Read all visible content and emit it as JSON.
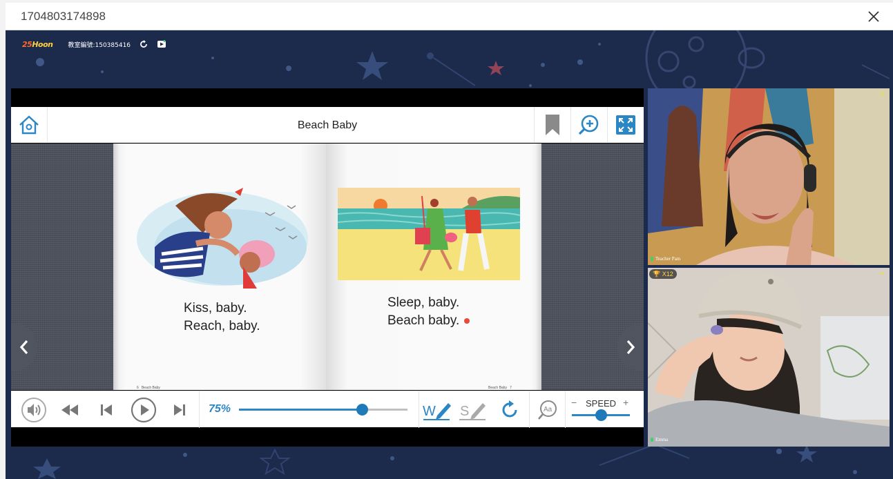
{
  "window": {
    "title": "1704803174898"
  },
  "top_info": {
    "logo_part1": "25",
    "logo_part2": "Hoon",
    "room_label": "教室編號:150385416"
  },
  "reader": {
    "book_title": "Beach Baby",
    "left_page": {
      "line1": "Kiss, baby.",
      "line2": "Reach, baby.",
      "page_no": "6",
      "footer": "Beach Baby"
    },
    "right_page": {
      "line1": "Sleep, baby.",
      "line2": "Beach baby.",
      "page_no": "7",
      "footer": "Beach Baby"
    },
    "zoom_label": "75%",
    "zoom_value": 0.73,
    "speed_label": "SPEED",
    "speed_minus": "−",
    "speed_plus": "+",
    "speed_value": 0.5
  },
  "videos": [
    {
      "name": "Teacher Pam"
    },
    {
      "name": "Emma",
      "trophy": "X12"
    }
  ],
  "colors": {
    "accent": "#2a86c5",
    "background": "#1c2a4c"
  }
}
